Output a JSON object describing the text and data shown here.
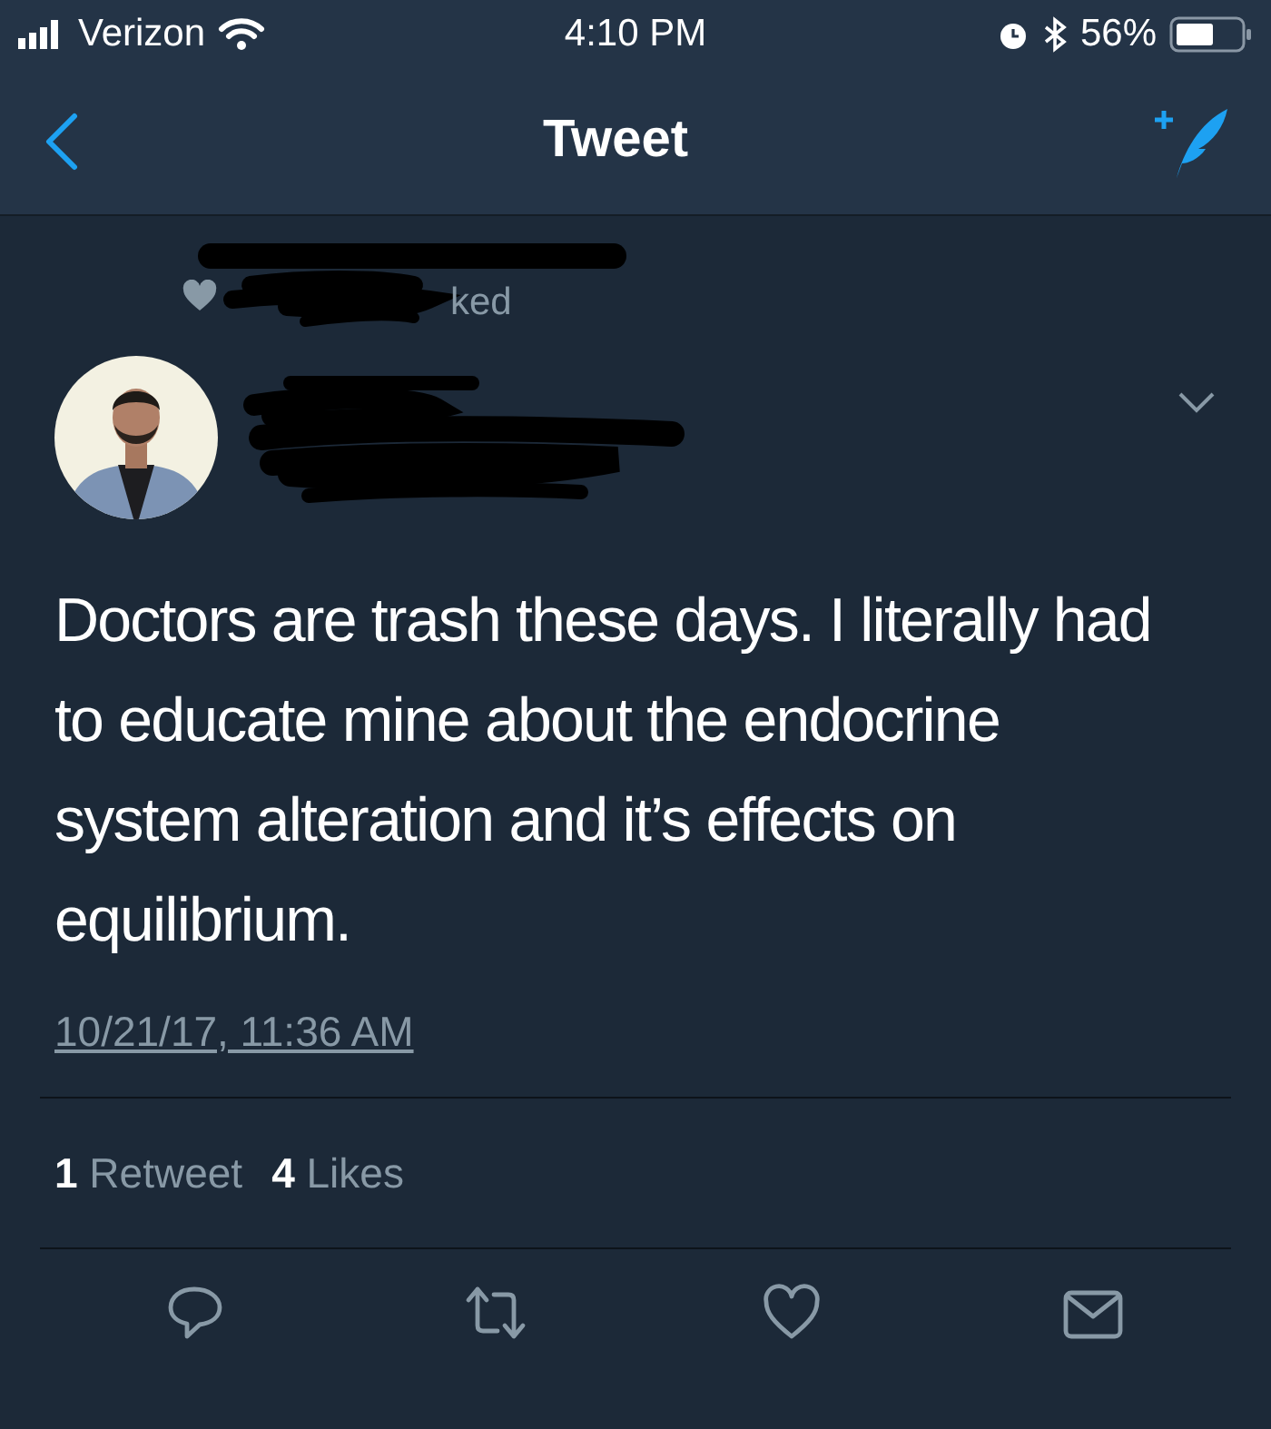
{
  "status_bar": {
    "carrier": "Verizon",
    "time": "4:10 PM",
    "battery": "56%"
  },
  "nav_bar": {
    "title": "Tweet"
  },
  "tweet": {
    "social_context": "ked",
    "text": "Doctors are trash these days. I literally had to educate mine about the endocrine system alteration and it’s effects on equilibrium.",
    "timestamp": "10/21/17, 11:36 AM",
    "stats": [
      {
        "count": "1",
        "label": "Retweet"
      },
      {
        "count": "4",
        "label": "Likes"
      }
    ]
  }
}
